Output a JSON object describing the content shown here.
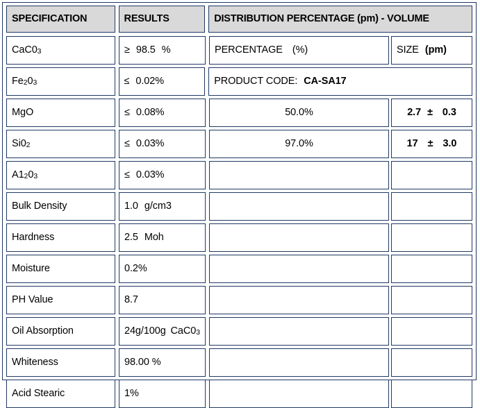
{
  "document": {
    "type": "product-specification-table",
    "border_color": "#1f3864",
    "header_fill": "#d9d9d9",
    "background": "#ffffff"
  },
  "header": {
    "specification": "SPECIFICATION",
    "results": "RESULTS",
    "distribution": "DISTRIBUTION PERCENTAGE (pm) - VOLUME"
  },
  "subheader": {
    "percentage_label": "PERCENTAGE",
    "percentage_unit": "(%)",
    "size_label": "SIZE",
    "size_unit": "(pm)"
  },
  "product_code": {
    "label": "PRODUCT  CODE:",
    "value": "CA-SA17"
  },
  "rows": [
    {
      "spec_main": "CaC0",
      "spec_sub": "3",
      "spec_tail": "",
      "result_op": "≥",
      "result_value": "98.5",
      "result_unit": "%"
    },
    {
      "spec_main": "Fe",
      "spec_sub": "2",
      "spec_tail": "0",
      "spec_sub2": "3",
      "result_op": "≤",
      "result_value": "0.02%",
      "result_unit": ""
    },
    {
      "spec_main": "MgO",
      "spec_sub": "",
      "spec_tail": "",
      "result_op": "≤",
      "result_value": "0.08%",
      "result_unit": ""
    },
    {
      "spec_main": "Si0",
      "spec_sub": "2",
      "spec_tail": "",
      "result_op": "≤",
      "result_value": "0.03%",
      "result_unit": ""
    },
    {
      "spec_main": "A1",
      "spec_sub": "2",
      "spec_tail": "0",
      "spec_sub2": "3",
      "result_op": "≤",
      "result_value": "0.03%",
      "result_unit": ""
    },
    {
      "spec_main": "Bulk Density",
      "spec_sub": "",
      "spec_tail": "",
      "result_op": "",
      "result_value": "1.0",
      "result_unit": "g/cm3"
    },
    {
      "spec_main": "Hardness",
      "spec_sub": "",
      "spec_tail": "",
      "result_op": "",
      "result_value": "2.5",
      "result_unit": "Moh"
    },
    {
      "spec_main": "Moisture",
      "spec_sub": "",
      "spec_tail": "",
      "result_op": "",
      "result_value": "0.2%",
      "result_unit": ""
    },
    {
      "spec_main": "PH Value",
      "spec_sub": "",
      "spec_tail": "",
      "result_op": "",
      "result_value": "8.7",
      "result_unit": ""
    },
    {
      "spec_main": "Oil Absorption",
      "spec_sub": "",
      "spec_tail": "",
      "result_op": "",
      "result_value": "24g/100g",
      "result_unit": "CaC0",
      "result_unit_sub": "3"
    },
    {
      "spec_main": "Whiteness",
      "spec_sub": "",
      "spec_tail": "",
      "result_op": "",
      "result_value": "98.00 %",
      "result_unit": ""
    },
    {
      "spec_main": "Acid Stearic",
      "spec_sub": "",
      "spec_tail": "",
      "result_op": "",
      "result_value": "1%",
      "result_unit": ""
    }
  ],
  "distribution": {
    "entries": [
      {
        "percentage": "50.0%",
        "size_value": "2.7",
        "size_pm": "±",
        "size_tol": "0.3"
      },
      {
        "percentage": "97.0%",
        "size_value": "17",
        "size_pm": "±",
        "size_tol": "3.0"
      }
    ],
    "empty_row_count": 7
  }
}
